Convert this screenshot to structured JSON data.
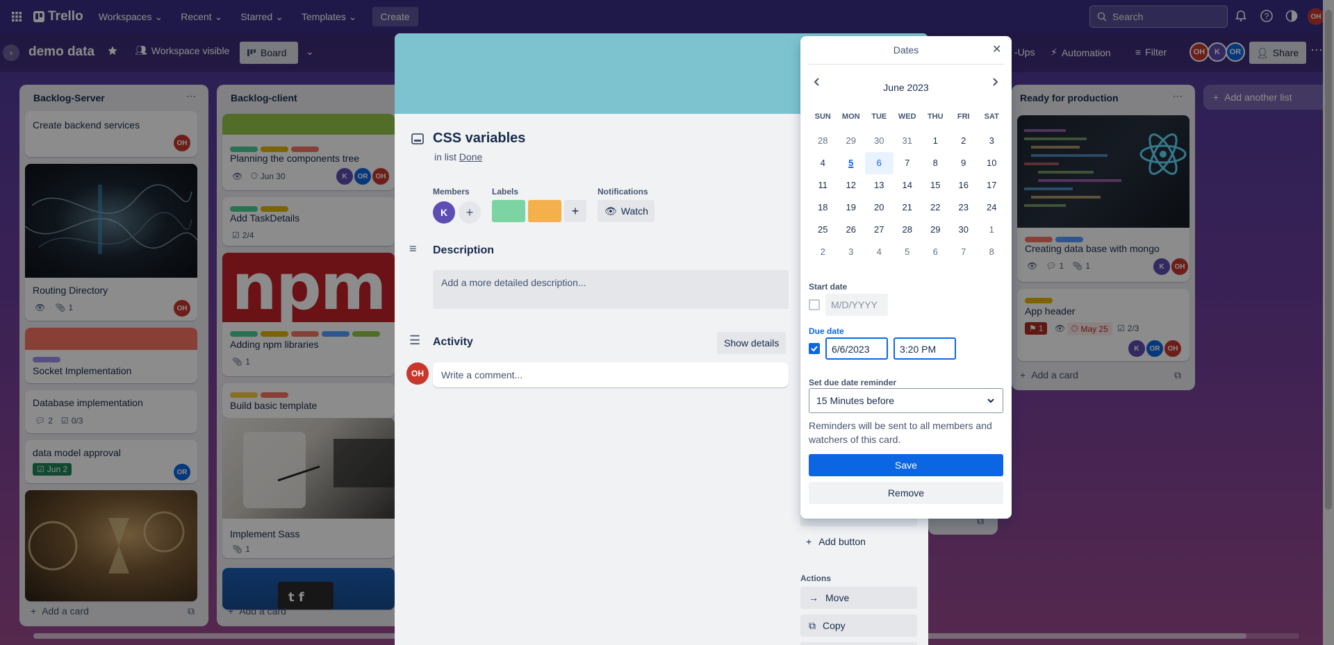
{
  "nav": {
    "logo": "Trello",
    "workspaces": "Workspaces",
    "recent": "Recent",
    "starred": "Starred",
    "templates": "Templates",
    "create": "Create",
    "search_placeholder": "Search",
    "user_initials": "OH"
  },
  "board": {
    "title": "demo data",
    "visibility": "Workspace visible",
    "view": "Board",
    "powerups": "-Ups",
    "automation": "Automation",
    "filter": "Filter",
    "share": "Share",
    "members": [
      "OH",
      "K",
      "OR"
    ]
  },
  "lists": {
    "server": {
      "title": "Backlog-Server",
      "c1": {
        "title": "Create backend services",
        "member": "OH"
      },
      "c2": {
        "title": "Routing Directory",
        "attachments": "1",
        "member": "OH"
      },
      "c3": {
        "title": "Socket Implementation"
      },
      "c4": {
        "title": "Database implementation",
        "comments": "2",
        "checklist": "0/3"
      },
      "c5": {
        "title": "data model approval",
        "due": "Jun 2",
        "member": "OR"
      },
      "add_card": "Add a card"
    },
    "client": {
      "title": "Backlog-client",
      "c1": {
        "title": "Planning the components tree",
        "due": "Jun 30",
        "members": [
          "K",
          "OR",
          "OH"
        ]
      },
      "c2": {
        "title": "Add TaskDetails",
        "checklist": "2/4"
      },
      "c3": {
        "title": "Adding npm libraries",
        "attachments": "1",
        "cover_text": "npm"
      },
      "c4": {
        "title": "Build basic template"
      },
      "c5": {
        "title": "Implement Sass",
        "attachments": "1"
      },
      "add_card": "Add a card"
    },
    "prod": {
      "title": "Ready for production",
      "c1": {
        "title": "Creating data base with mongo",
        "comments": "1",
        "attachments": "1",
        "members": [
          "K",
          "OH"
        ]
      },
      "c2": {
        "title": "App header",
        "badge": "1",
        "due": "May 25",
        "checklist": "2/3",
        "members": [
          "K",
          "OR",
          "OH"
        ]
      },
      "add_card": "Add a card"
    },
    "add_another": "Add another list"
  },
  "card_modal": {
    "title": "CSS variables",
    "in_list_prefix": "in list",
    "list_name": "Done",
    "members_label": "Members",
    "member_initial": "K",
    "labels_label": "Labels",
    "notifications_label": "Notifications",
    "watch": "Watch",
    "description_title": "Description",
    "description_placeholder": "Add a more detailed description...",
    "activity_title": "Activity",
    "show_details": "Show details",
    "comment_placeholder": "Write a comment...",
    "commenter": "OH",
    "add_button": "Add button",
    "actions_label": "Actions",
    "move": "Move",
    "copy": "Copy",
    "label_colors": [
      "#7bd4a2",
      "#f4b04d"
    ]
  },
  "dates": {
    "title": "Dates",
    "month": "June 2023",
    "weekdays": [
      "SUN",
      "MON",
      "TUE",
      "WED",
      "THU",
      "FRI",
      "SAT"
    ],
    "weeks": [
      [
        "28",
        "29",
        "30",
        "31",
        "1",
        "2",
        "3"
      ],
      [
        "4",
        "5",
        "6",
        "7",
        "8",
        "9",
        "10"
      ],
      [
        "11",
        "12",
        "13",
        "14",
        "15",
        "16",
        "17"
      ],
      [
        "18",
        "19",
        "20",
        "21",
        "22",
        "23",
        "24"
      ],
      [
        "25",
        "26",
        "27",
        "28",
        "29",
        "30",
        "1"
      ],
      [
        "2",
        "3",
        "4",
        "5",
        "6",
        "7",
        "8"
      ]
    ],
    "today": "5",
    "selected": "6",
    "start_label": "Start date",
    "start_placeholder": "M/D/YYYY",
    "start_checked": false,
    "due_label": "Due date",
    "due_checked": true,
    "due_date": "6/6/2023",
    "due_time": "3:20 PM",
    "reminder_label": "Set due date reminder",
    "reminder_value": "15 Minutes before",
    "reminder_note": "Reminders will be sent to all members and watchers of this card.",
    "save": "Save",
    "remove": "Remove"
  },
  "colors": {
    "accent": "#0c66e4",
    "cover": "#7cc3cf",
    "nav": "#3a2f86"
  }
}
